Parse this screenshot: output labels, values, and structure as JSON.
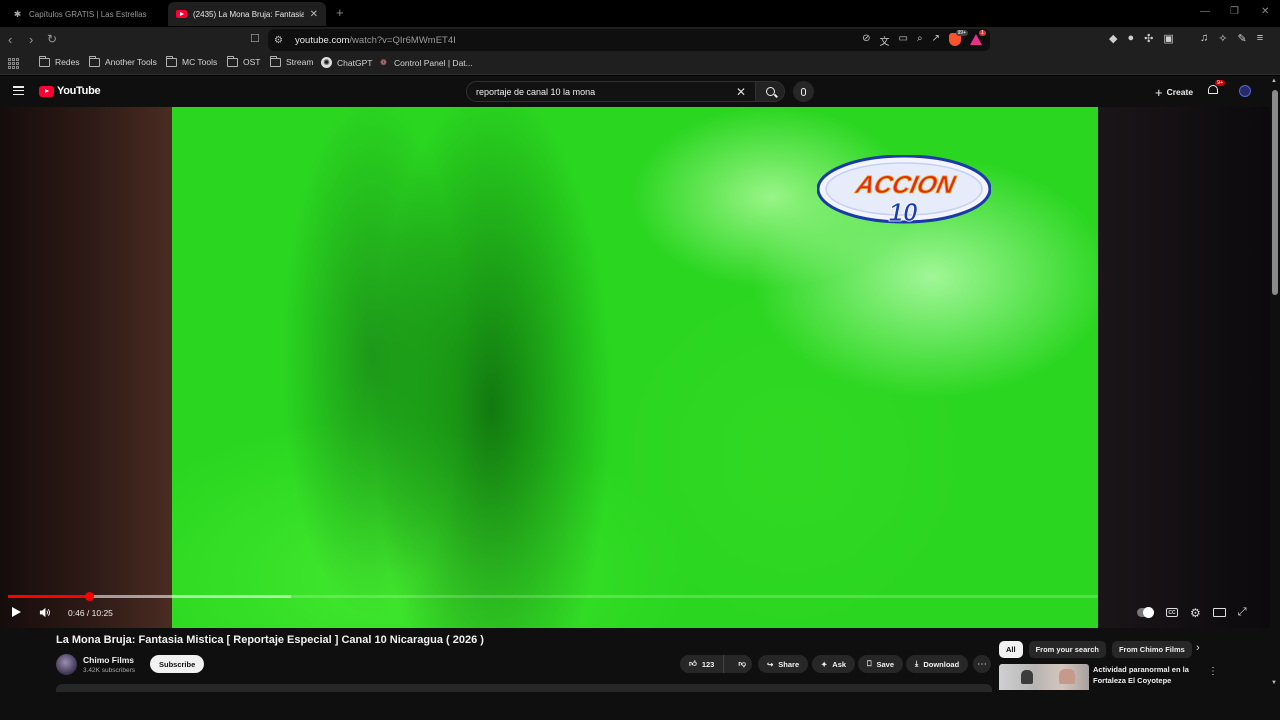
{
  "browser": {
    "tabs": [
      {
        "title": "Capítulos GRATIS | Las Estrellas",
        "active": false
      },
      {
        "title": "(2435) La Mona Bruja: Fantasia M",
        "active": true
      }
    ],
    "url_host": "youtube.com",
    "url_path": "/watch?v=QIr6MWmET4I",
    "shield_count": "99+",
    "rewards_count": "1",
    "bookmarks": [
      "Redes",
      "Another Tools",
      "MC Tools",
      "OST",
      "Stream",
      "ChatGPT",
      "Control Panel | Dat..."
    ]
  },
  "youtube": {
    "logo_text": "YouTube",
    "search_value": "reportaje de canal 10 la mona",
    "create_label": "Create",
    "notif_badge": "9+",
    "player": {
      "time": "0:46 / 10:25",
      "played_fraction": 0.074,
      "loaded_fraction": 0.26,
      "channel_logo_text": "ACCION",
      "channel_logo_number": "10"
    },
    "video_title": "La Mona Bruja: Fantasia Mistica [ Reportaje Especial ] Canal 10 Nicaragua ( 2026 )",
    "channel": {
      "name": "Chimo Films",
      "subs": "3.42K subscribers",
      "subscribe_label": "Subscribe"
    },
    "actions": {
      "likes": "123",
      "share": "Share",
      "ask": "Ask",
      "save": "Save",
      "download": "Download"
    },
    "chips": [
      "All",
      "From your search",
      "From Chimo Films"
    ],
    "recommendation": {
      "title": "Actividad paranormal en la Fortaleza El Coyotepe"
    }
  },
  "colors": {
    "accent": "#ff0033",
    "video_green": "#2ad620",
    "background": "#0f0f0f"
  }
}
